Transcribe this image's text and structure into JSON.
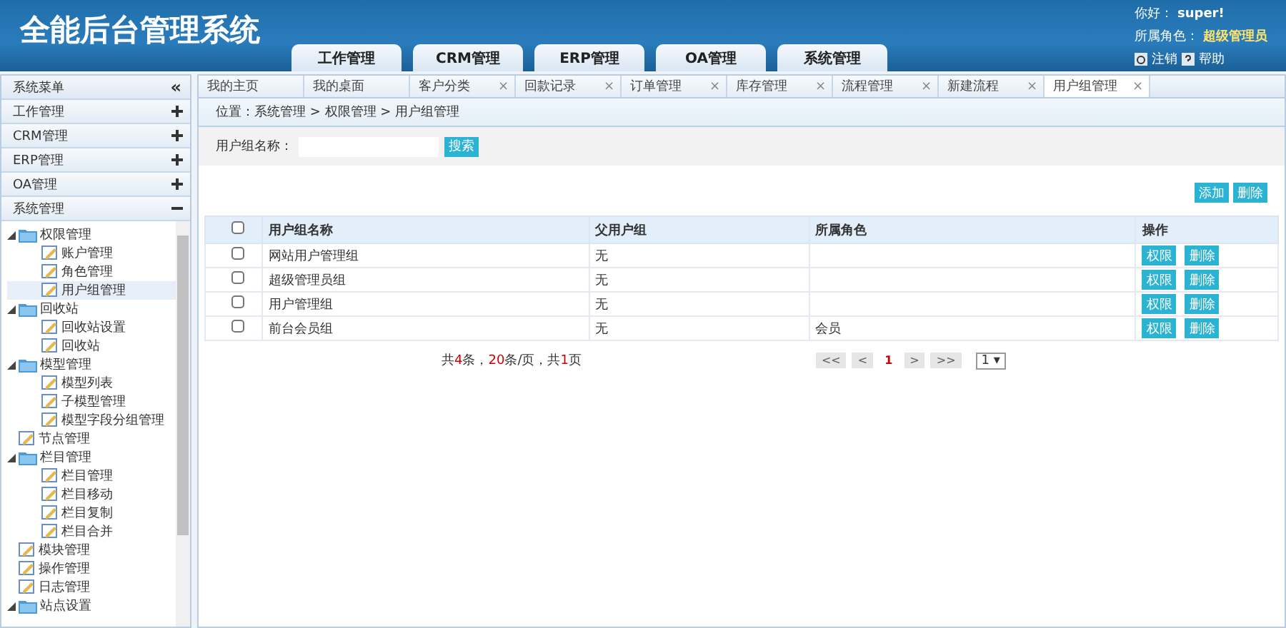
{
  "header": {
    "title": "全能后台管理系统",
    "nav": [
      "工作管理",
      "CRM管理",
      "ERP管理",
      "OA管理",
      "系统管理"
    ],
    "user": {
      "greeting": "你好：",
      "name": "super!",
      "role_label": "所属角色：",
      "role": "超级管理员",
      "logout": "注销",
      "help": "帮助"
    }
  },
  "sidebar": {
    "title": "系统菜单",
    "collapse": "«",
    "sections": [
      {
        "label": "工作管理",
        "expanded": false
      },
      {
        "label": "CRM管理",
        "expanded": false
      },
      {
        "label": "ERP管理",
        "expanded": false
      },
      {
        "label": "OA管理",
        "expanded": false
      },
      {
        "label": "系统管理",
        "expanded": true
      }
    ],
    "tree": [
      {
        "label": "权限管理",
        "kind": "folder",
        "expanded": true,
        "children": [
          {
            "label": "账户管理",
            "kind": "page",
            "selected": false
          },
          {
            "label": "角色管理",
            "kind": "page",
            "selected": false
          },
          {
            "label": "用户组管理",
            "kind": "page",
            "selected": true
          }
        ]
      },
      {
        "label": "回收站",
        "kind": "folder",
        "expanded": true,
        "children": [
          {
            "label": "回收站设置",
            "kind": "page",
            "selected": false
          },
          {
            "label": "回收站",
            "kind": "page",
            "selected": false
          }
        ]
      },
      {
        "label": "模型管理",
        "kind": "folder",
        "expanded": true,
        "children": [
          {
            "label": "模型列表",
            "kind": "page",
            "selected": false
          },
          {
            "label": "子模型管理",
            "kind": "page",
            "selected": false
          },
          {
            "label": "模型字段分组管理",
            "kind": "page",
            "selected": false
          }
        ]
      },
      {
        "label": "节点管理",
        "kind": "page",
        "selected": false
      },
      {
        "label": "栏目管理",
        "kind": "folder",
        "expanded": true,
        "children": [
          {
            "label": "栏目管理",
            "kind": "page",
            "selected": false
          },
          {
            "label": "栏目移动",
            "kind": "page",
            "selected": false
          },
          {
            "label": "栏目复制",
            "kind": "page",
            "selected": false
          },
          {
            "label": "栏目合并",
            "kind": "page",
            "selected": false
          }
        ]
      },
      {
        "label": "模块管理",
        "kind": "page",
        "selected": false
      },
      {
        "label": "操作管理",
        "kind": "page",
        "selected": false
      },
      {
        "label": "日志管理",
        "kind": "page",
        "selected": false
      },
      {
        "label": "站点设置",
        "kind": "folder",
        "expanded": true
      }
    ]
  },
  "tabs": [
    {
      "label": "我的主页",
      "closable": false,
      "selected": false
    },
    {
      "label": "我的桌面",
      "closable": false,
      "selected": false
    },
    {
      "label": "客户分类",
      "closable": true,
      "selected": false
    },
    {
      "label": "回款记录",
      "closable": true,
      "selected": false
    },
    {
      "label": "订单管理",
      "closable": true,
      "selected": false
    },
    {
      "label": "库存管理",
      "closable": true,
      "selected": false
    },
    {
      "label": "流程管理",
      "closable": true,
      "selected": false
    },
    {
      "label": "新建流程",
      "closable": true,
      "selected": false
    },
    {
      "label": "用户组管理",
      "closable": true,
      "selected": true
    }
  ],
  "close_glyph": "×",
  "breadcrumb": "位置：系统管理 > 权限管理 > 用户组管理",
  "search": {
    "label": "用户组名称：",
    "button": "搜索"
  },
  "actions": [
    "添加",
    "删除"
  ],
  "table": {
    "select_all_checked": false,
    "columns": [
      "用户组名称",
      "父用户组",
      "所属角色",
      "操作"
    ],
    "rows": [
      {
        "name": "网站用户管理组",
        "parent": "无",
        "role": "",
        "checked": false,
        "buttons": [
          "权限",
          "删除"
        ]
      },
      {
        "name": "超级管理员组",
        "parent": "无",
        "role": "",
        "checked": false,
        "buttons": [
          "权限",
          "删除"
        ]
      },
      {
        "name": "用户管理组",
        "parent": "无",
        "role": "",
        "checked": false,
        "buttons": [
          "权限",
          "删除"
        ]
      },
      {
        "name": "前台会员组",
        "parent": "无",
        "role": "会员",
        "checked": false,
        "buttons": [
          "权限",
          "删除"
        ]
      }
    ]
  },
  "pagination": {
    "summary": [
      {
        "text": "共",
        "highlight": false
      },
      {
        "text": "4",
        "highlight": true
      },
      {
        "text": "条，",
        "highlight": false
      },
      {
        "text": "20",
        "highlight": true
      },
      {
        "text": "条/页，共",
        "highlight": false
      },
      {
        "text": "1",
        "highlight": true
      },
      {
        "text": "页",
        "highlight": false
      }
    ],
    "buttons": [
      {
        "label": "<<",
        "current": false
      },
      {
        "label": "<",
        "current": false
      },
      {
        "label": "1",
        "current": true
      },
      {
        "label": ">",
        "current": false
      },
      {
        "label": ">>",
        "current": false
      }
    ],
    "page_select": "1 ▾"
  }
}
